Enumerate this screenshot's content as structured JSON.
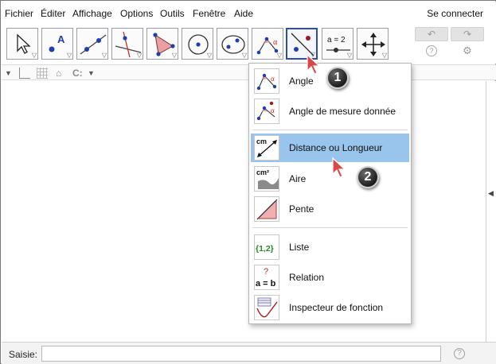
{
  "menu": {
    "items": [
      "Fichier",
      "Éditer",
      "Affichage",
      "Options",
      "Outils",
      "Fenêtre",
      "Aide"
    ],
    "login": "Se connecter"
  },
  "toolbar": {
    "tools": [
      {
        "name": "move-tool",
        "icon": "cursor-arrow-icon"
      },
      {
        "name": "point-tool",
        "icon": "point-a-icon"
      },
      {
        "name": "line-tool",
        "icon": "line-through-points-icon"
      },
      {
        "name": "perpendicular-tool",
        "icon": "perpendicular-line-icon"
      },
      {
        "name": "polygon-tool",
        "icon": "polygon-icon"
      },
      {
        "name": "circle-tool",
        "icon": "circle-center-point-icon"
      },
      {
        "name": "conic-tool",
        "icon": "ellipse-icon"
      },
      {
        "name": "angle-tool",
        "icon": "angle-icon"
      },
      {
        "name": "reflect-tool",
        "icon": "reflect-line-icon"
      },
      {
        "name": "slider-tool",
        "icon": "slider-icon",
        "label": "a = 2"
      },
      {
        "name": "move-view-tool",
        "icon": "move-view-icon"
      }
    ],
    "active_tool_index": 8,
    "undo_glyph": "↶",
    "redo_glyph": "↷",
    "help_glyph": "?",
    "settings_glyph": "⚙"
  },
  "dropdown": {
    "items": [
      {
        "label": "Angle",
        "icon": "angle-icon"
      },
      {
        "label": "Angle de mesure donnée",
        "icon": "angle-given-size-icon"
      },
      {
        "label": "Distance ou Longueur",
        "icon": "distance-length-icon",
        "highlighted": true
      },
      {
        "label": "Aire",
        "icon": "area-icon"
      },
      {
        "label": "Pente",
        "icon": "slope-icon"
      },
      {
        "label": "Liste",
        "icon": "list-icon"
      },
      {
        "label": "Relation",
        "icon": "relation-icon"
      },
      {
        "label": "Inspecteur de fonction",
        "icon": "function-inspector-icon"
      }
    ],
    "icon_texts": {
      "alpha": "α",
      "cm": "cm",
      "cm2": "cm²",
      "list": "{1,2}",
      "relation": "a = b",
      "question": "?"
    }
  },
  "callouts": [
    "1",
    "2"
  ],
  "inputbar": {
    "label": "Saisie:",
    "value": "",
    "help_glyph": "?"
  },
  "colors": {
    "highlight": "#99c4ec",
    "active_border": "#2c4da8",
    "point_blue": "#1f3fae",
    "angle_fill": "#e8a0a0",
    "list_green": "#2a8a2a",
    "relation_red": "#cc2222"
  }
}
